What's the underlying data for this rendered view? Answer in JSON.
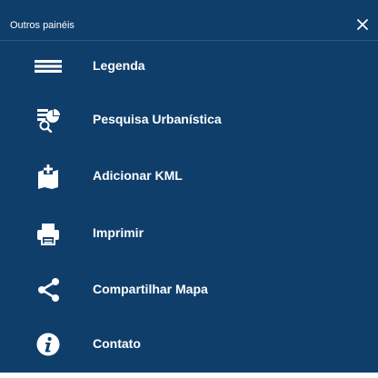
{
  "panel": {
    "title": "Outros painéis",
    "close_icon": "close-icon",
    "background_color": "#0f3e6b"
  },
  "menu": {
    "items": [
      {
        "label": "Legenda",
        "icon": "list-icon"
      },
      {
        "label": "Pesquisa Urbanística",
        "icon": "urban-search-icon"
      },
      {
        "label": "Adicionar KML",
        "icon": "add-kml-map-icon"
      },
      {
        "label": "Imprimir",
        "icon": "printer-icon"
      },
      {
        "label": "Compartilhar Mapa",
        "icon": "share-icon"
      },
      {
        "label": "Contato",
        "icon": "info-icon"
      }
    ]
  }
}
